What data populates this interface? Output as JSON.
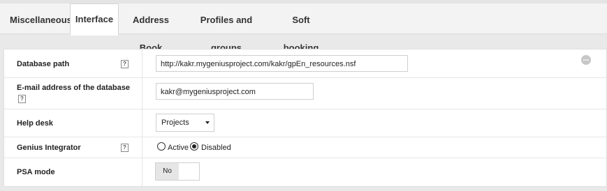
{
  "tabs": [
    "Miscellaneous",
    "Interface",
    "Address Book",
    "Profiles and groups",
    "Soft booking"
  ],
  "active_tab": "Interface",
  "fields": {
    "database_path": {
      "label": "Database path",
      "value": "http://kakr.mygeniusproject.com/kakr/gpEn_resources.nsf"
    },
    "email_address": {
      "label": "E-mail address of the database",
      "value": "kakr@mygeniusproject.com"
    },
    "help_desk": {
      "label": "Help desk",
      "selected": "Projects"
    },
    "genius_integrator": {
      "label": "Genius Integrator",
      "options": [
        "Active",
        "Disabled"
      ],
      "selected": "Disabled"
    },
    "psa_mode": {
      "label": "PSA mode",
      "value": "No"
    }
  },
  "help_glyph": "?",
  "icons": {
    "help": "help-icon",
    "more": "more-options-icon",
    "dropdown": "chevron-down-icon"
  }
}
